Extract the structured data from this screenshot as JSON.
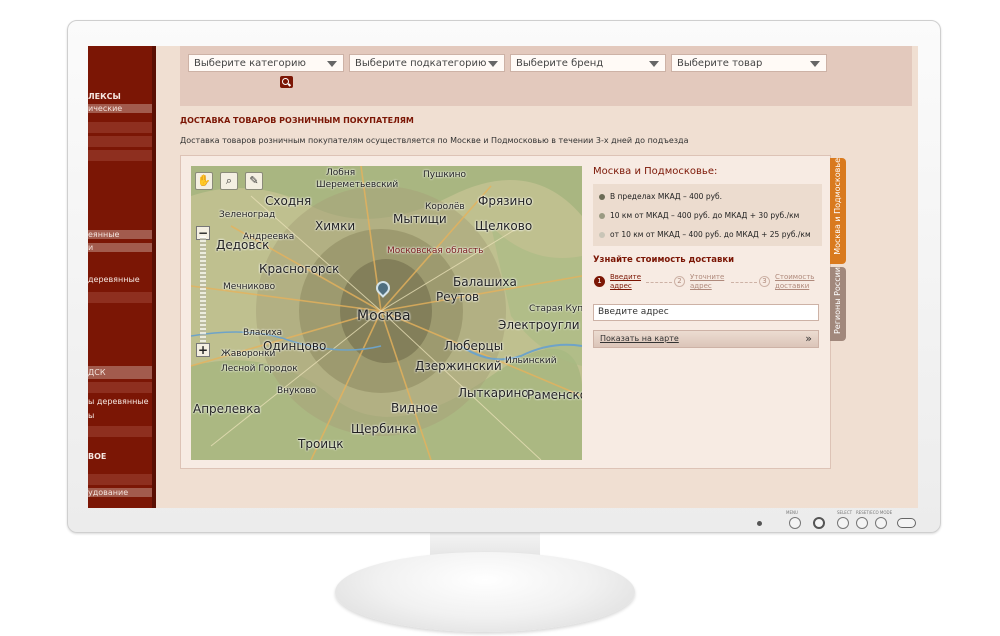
{
  "sidebar": {
    "items": [
      "ЛЕКСЫ",
      "ические",
      "еянные",
      "и",
      "деревянные",
      "ДСК",
      "ы деревянные",
      "ы",
      "ВОЕ",
      "удование"
    ]
  },
  "filters": {
    "category": "Выберите категорию",
    "subcategory": "Выберите подкатегорию",
    "brand": "Выберите бренд",
    "product": "Выберите товар"
  },
  "page": {
    "title": "ДОСТАВКА ТОВАРОВ РОЗНИЧНЫМ ПОКУПАТЕЛЯМ",
    "description": "Доставка товаров розничным покупателям осуществляется по Москве и Подмосковью в течении 3-х дней до подъезда"
  },
  "map": {
    "cities": [
      "Лобня",
      "Пушкино",
      "Шереметьевский",
      "Сходня",
      "Фрязино",
      "Химки",
      "Мытищи",
      "Щелково",
      "Дедовск",
      "Красногорск",
      "Королёв",
      "Московская область",
      "Балашиха",
      "Реутов",
      "Москва",
      "Электроугли",
      "Одинцово",
      "Люберцы",
      "Дзержинский",
      "Жаворонки",
      "Апрелевка",
      "Видное",
      "Лыткарино",
      "Раменское",
      "Троицк",
      "Щербинка",
      "Старая Купавна",
      "Власиха",
      "Лесной Городок",
      "Внуково",
      "Андреевка",
      "Мечниково",
      "Зеленоград",
      "Ильинский"
    ],
    "tools": [
      "hand-icon",
      "zoom-icon",
      "ruler-icon"
    ]
  },
  "delivery": {
    "region_title": "Москва и Подмосковье:",
    "zones": [
      {
        "text": "В пределах МКАД – 400 руб.",
        "color": "#6b6b55"
      },
      {
        "text": "10 км от МКАД – 400 руб. до МКАД + 30 руб./км",
        "color": "#9a9a82"
      },
      {
        "text": "от 10 км от МКАД – 400 руб. до МКАД + 25 руб./км",
        "color": "#c9c5b7"
      }
    ],
    "calc_title": "Узнайте стоимость доставки",
    "steps": [
      {
        "num": "1",
        "label1": "Введите",
        "label2": "адрес"
      },
      {
        "num": "2",
        "label1": "Уточните",
        "label2": "адрес"
      },
      {
        "num": "3",
        "label1": "Стоимость",
        "label2": "доставки"
      }
    ],
    "address_value": "Введите адрес",
    "show_map_label": "Показать на карте",
    "show_map_arrow": "»"
  },
  "tabs": {
    "moscow": "Москва и Подмосковье",
    "regions": "Регионы России"
  },
  "monitor": {
    "labels": [
      "MENU",
      "SELECT",
      "RESET/ECO MODE"
    ]
  }
}
